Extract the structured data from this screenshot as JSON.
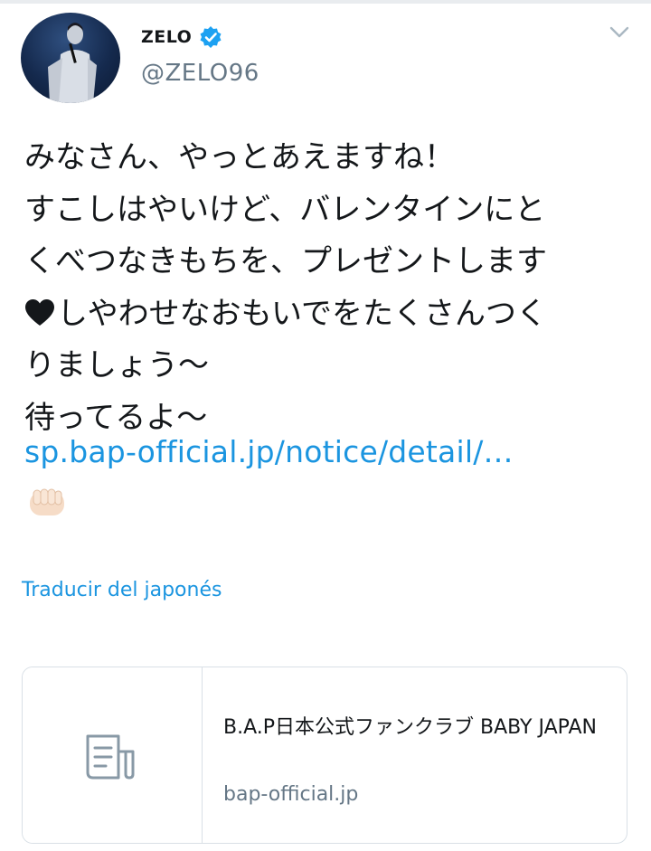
{
  "user": {
    "display_name": "ZELO",
    "handle": "@ZELO96",
    "verified": true,
    "avatar": "profile-photo"
  },
  "tweet": {
    "lines": [
      "みなさん、やっとあえますね！",
      "すこしはやいけど、バレンタインにと",
      "くべつなきもちを、プレゼントします",
      "しやわせなおもいでをたくさんつく",
      "りましょう～",
      "待ってるよ～"
    ],
    "heart_emoji": "black-heart",
    "link": "sp.bap-official.jp/notice/detail/…",
    "trailing_emoji": "fist-emoji"
  },
  "translate_label": "Traducir del japonés",
  "card": {
    "icon": "document-icon",
    "title": "B.A.P日本公式ファンクラブ BABY JAPAN",
    "domain": "bap-official.jp"
  },
  "colors": {
    "accent": "#1b95e0",
    "secondary_text": "#657786",
    "border": "#d9e0e6"
  }
}
